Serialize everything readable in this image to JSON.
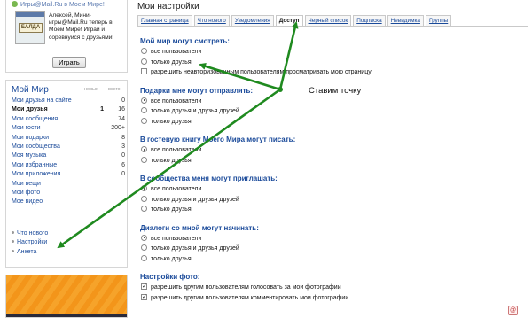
{
  "promo": {
    "title": "Игры@Mail.Ru в Моем Мире!",
    "game_logo": "БАЛДА",
    "text": "Алексей, Мини-игры@Mail.Ru теперь в Моем Мире! Играй и соревнуйся с друзьями!",
    "play_label": "Играть"
  },
  "myworld": {
    "title": "Мой Мир",
    "col_new": "новых",
    "col_total": "всего",
    "items": [
      {
        "label": "Мои друзья на сайте",
        "new": "",
        "total": "0",
        "bold": false
      },
      {
        "label": "Мои друзья",
        "new": "1",
        "total": "16",
        "bold": true
      },
      {
        "label": "Мои сообщения",
        "new": "",
        "total": "74",
        "bold": false
      },
      {
        "label": "Мои гости",
        "new": "",
        "total": "200+",
        "bold": false
      },
      {
        "label": "Мои подарки",
        "new": "",
        "total": "8",
        "bold": false
      },
      {
        "label": "Мои сообщества",
        "new": "",
        "total": "3",
        "bold": false
      },
      {
        "label": "Моя музыка",
        "new": "",
        "total": "0",
        "bold": false
      },
      {
        "label": "Мои избранные",
        "new": "",
        "total": "6",
        "bold": false
      },
      {
        "label": "Мои приложения",
        "new": "",
        "total": "0",
        "bold": false
      },
      {
        "label": "Мои вещи",
        "new": "",
        "total": "",
        "bold": false
      },
      {
        "label": "Мои фото",
        "new": "",
        "total": "",
        "bold": false
      },
      {
        "label": "Мое видео",
        "new": "",
        "total": "",
        "bold": false
      }
    ],
    "bottom": [
      "Что нового",
      "Настройки",
      "Анкета"
    ]
  },
  "page": {
    "title": "Мои настройки",
    "tabs": [
      "Главная страница",
      "Что нового",
      "Уведомления",
      "Доступ",
      "Черный список",
      "Подписка",
      "Невидимка",
      "Группы"
    ],
    "active_tab": "Доступ"
  },
  "sections": [
    {
      "title": "Мой мир могут смотреть:",
      "options": [
        {
          "type": "radio",
          "label": "все пользователи",
          "checked": false
        },
        {
          "type": "radio",
          "label": "только друзья",
          "checked": false
        },
        {
          "type": "check",
          "label": "разрешить неавторизованным пользователям просматривать мою страницу",
          "checked": false
        }
      ]
    },
    {
      "title": "Подарки мне могут отправлять:",
      "options": [
        {
          "type": "radio",
          "label": "все пользователи",
          "checked": true
        },
        {
          "type": "radio",
          "label": "только друзья и друзья друзей",
          "checked": false
        },
        {
          "type": "radio",
          "label": "только друзья",
          "checked": false
        }
      ]
    },
    {
      "title": "В гостевую книгу Моего Мира могут писать:",
      "options": [
        {
          "type": "radio",
          "label": "все пользователи",
          "checked": true
        },
        {
          "type": "radio",
          "label": "только друзья",
          "checked": false
        }
      ]
    },
    {
      "title": "В сообщества меня могут приглашать:",
      "options": [
        {
          "type": "radio",
          "label": "все пользователи",
          "checked": true
        },
        {
          "type": "radio",
          "label": "только друзья и друзья друзей",
          "checked": false
        },
        {
          "type": "radio",
          "label": "только друзья",
          "checked": false
        }
      ]
    },
    {
      "title": "Диалоги со мной могут начинать:",
      "options": [
        {
          "type": "radio",
          "label": "все пользователи",
          "checked": true
        },
        {
          "type": "radio",
          "label": "только друзья и друзья друзей",
          "checked": false
        },
        {
          "type": "radio",
          "label": "только друзья",
          "checked": false
        }
      ]
    },
    {
      "title": "Настройки фото:",
      "options": [
        {
          "type": "check",
          "label": "разрешить другим пользователям голосовать за мои фотографии",
          "checked": true
        },
        {
          "type": "check",
          "label": "разрешить другим пользователям комментировать мои фотографии",
          "checked": true
        }
      ]
    }
  ],
  "annotation": {
    "text": "Ставим точку",
    "arrow_color": "#1f8a1f"
  },
  "colors": {
    "link": "#1a4a9a",
    "arrow": "#1f8a1f"
  }
}
